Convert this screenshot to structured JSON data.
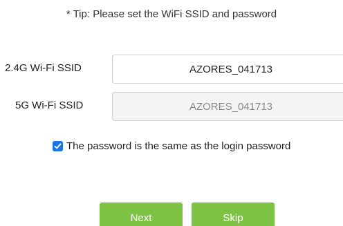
{
  "tip": "* Tip: Please set the WiFi SSID and password",
  "ssid_24": {
    "label": "2.4G Wi-Fi SSID",
    "value": "AZORES_041713"
  },
  "ssid_5": {
    "label": "5G Wi-Fi SSID",
    "value": "AZORES_041713"
  },
  "same_password": {
    "checked": true,
    "label": "The password is the same as the login password"
  },
  "buttons": {
    "next": "Next",
    "skip": "Skip"
  },
  "colors": {
    "button_green": "#7dc242",
    "checkbox_blue": "#1a73e8",
    "disabled_field_bg": "#f4f4f4"
  },
  "icons": {
    "checkbox": "checkmark-icon"
  }
}
